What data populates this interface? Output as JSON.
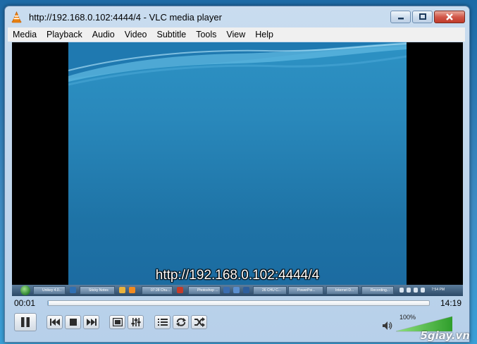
{
  "window": {
    "title": "http://192.168.0.102:4444/4 - VLC media player"
  },
  "menu": [
    "Media",
    "Playback",
    "Audio",
    "Video",
    "Subtitle",
    "Tools",
    "View",
    "Help"
  ],
  "video": {
    "osd_text": "http://192.168.0.102:4444/4",
    "inner_taskbar_items": [
      "Unikey 4.0...",
      "Sticky Notes",
      "07:28 Chu...",
      "Photoshop ...",
      "26 CHU C...",
      "PowerPoi...",
      "Internet D...",
      "Recording..."
    ],
    "inner_clock": "7:54 PM"
  },
  "playback": {
    "elapsed": "00:01",
    "total": "14:19",
    "progress": 0.001
  },
  "controls": {
    "icons": [
      "pause-icon",
      "previous-icon",
      "stop-icon",
      "next-icon",
      "fullscreen-icon",
      "extended-settings-icon",
      "playlist-icon",
      "loop-icon",
      "shuffle-icon",
      "speaker-icon"
    ]
  },
  "volume": {
    "label": "100%",
    "level": 1.0
  },
  "watermark": "5giay.vn",
  "colors": {
    "accent_blue": "#3b8fd0",
    "volume_green": "#3fb83a",
    "close_red": "#c03a2a"
  }
}
